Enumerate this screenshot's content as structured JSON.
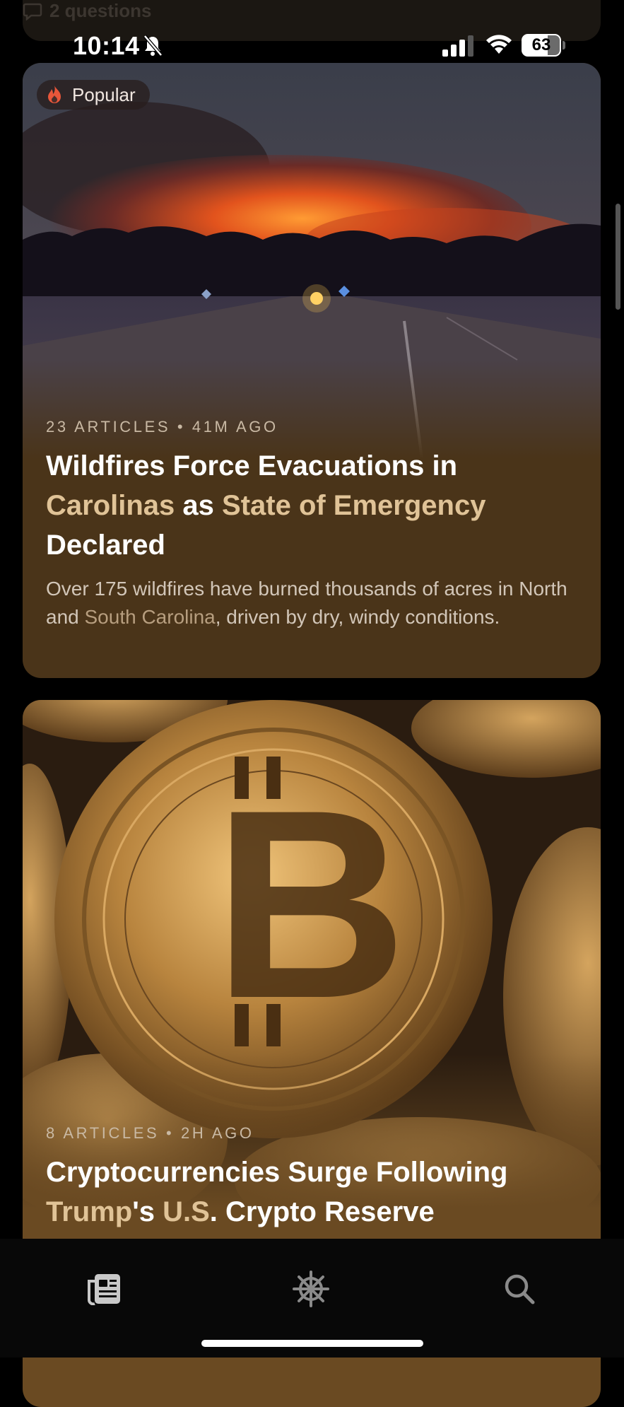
{
  "status_bar": {
    "time": "10:14",
    "battery": "63",
    "icons": [
      "bell-off-icon",
      "cellular-signal-icon",
      "wifi-icon",
      "battery-icon"
    ]
  },
  "previous_card": {
    "meta": "2 questions",
    "icon": "chat-bubble-icon"
  },
  "stories": [
    {
      "badge": "Popular",
      "badge_icon": "flame-icon",
      "meta": "23 ARTICLES • 41M AGO",
      "headline": {
        "p1": "Wildfires Force Evacuations in ",
        "h1": "Carolinas",
        "p2": " as ",
        "h2": "State of Emergency",
        "p3": " Declared"
      },
      "summary": {
        "p1": "Over 175 wildfires have burned thousands of acres in North and ",
        "link": "South Carolina",
        "p2": ", driven by dry, windy conditions."
      },
      "image": "wildfire-night-road-photo"
    },
    {
      "meta": "8 ARTICLES • 2H AGO",
      "headline": {
        "p1": "Cryptocurrencies Surge Following ",
        "h1": "Trump",
        "p2": "'s ",
        "h2": "U.S",
        "p3": ". Crypto Reserve"
      },
      "image": "bitcoin-coins-photo"
    }
  ],
  "tab_bar": {
    "tabs": [
      {
        "name": "news",
        "icon": "newspaper-icon",
        "active": true
      },
      {
        "name": "explore",
        "icon": "helm-wheel-icon",
        "active": false
      },
      {
        "name": "search",
        "icon": "search-icon",
        "active": false
      }
    ]
  },
  "colors": {
    "highlight": "#e0c397",
    "card1_bg": "#4a3419",
    "card2_bg": "#6a4a22",
    "badge_flame": "#e8563a"
  }
}
